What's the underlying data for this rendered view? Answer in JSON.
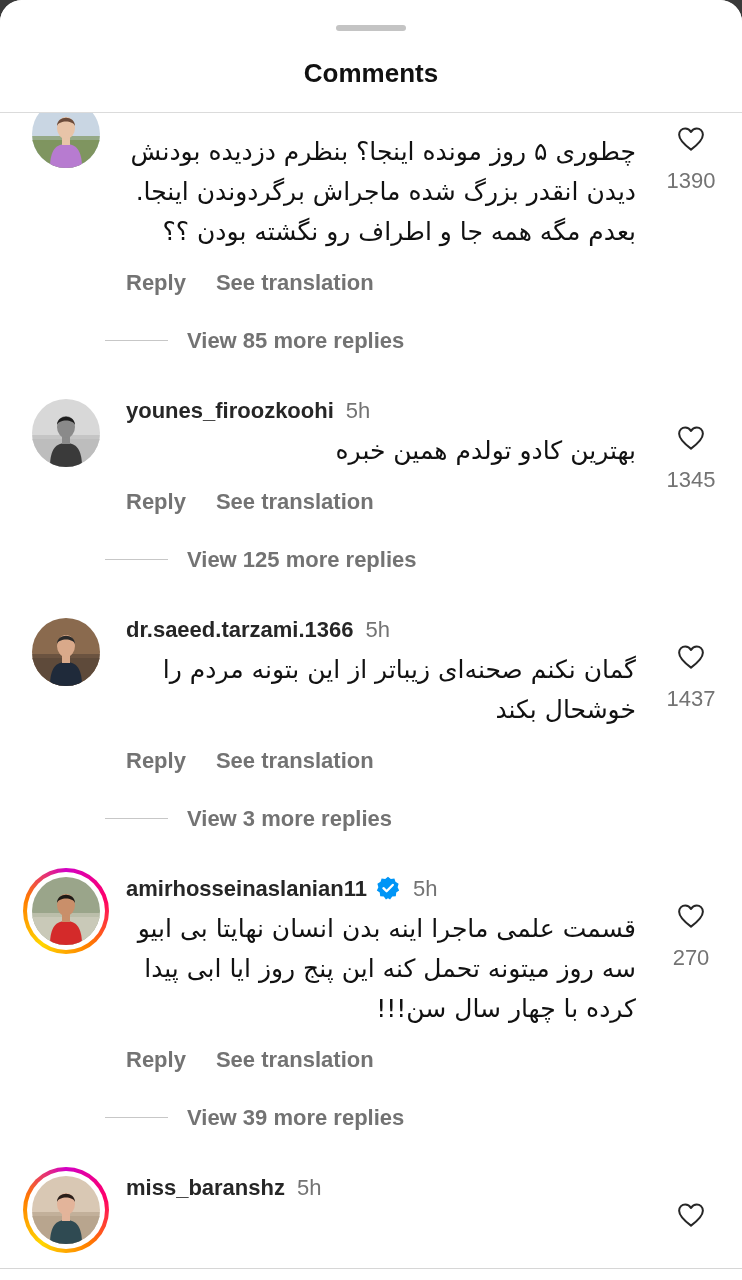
{
  "title": "Comments",
  "comments": [
    {
      "story_ring": false,
      "verified": false,
      "text": "چطوری ۵ روز مونده اینجا؟ بنظرم دزدیده بودنش دیدن انقدر بزرگ شده ماجراش برگردوندن اینجا. بعدم مگه همه جا و اطراف رو نگشته بودن ؟؟",
      "liked": false,
      "likes": "1390",
      "reply": "Reply",
      "translate": "See translation",
      "view_replies": "View 85 more replies"
    },
    {
      "username": "younes_firoozkoohi",
      "time": "5h",
      "story_ring": false,
      "verified": false,
      "text": "بهترین کادو تولدم همین خبره",
      "liked": false,
      "likes": "1345",
      "reply": "Reply",
      "translate": "See translation",
      "view_replies": "View 125 more replies"
    },
    {
      "username": "dr.saeed.tarzami.1366",
      "time": "5h",
      "story_ring": false,
      "verified": false,
      "text": "گمان نکنم صحنه‌ای زیباتر از این بتونه مردم را خوشحال بکند",
      "liked": false,
      "likes": "1437",
      "reply": "Reply",
      "translate": "See translation",
      "view_replies": "View 3 more replies"
    },
    {
      "username": "amirhosseinaslanian11",
      "time": "5h",
      "story_ring": true,
      "verified": true,
      "text": "قسمت علمی ماجرا اینه بدن انسان نهایتا بی ابیو سه روز میتونه تحمل کنه این پنج روز ایا ابی پیدا کرده با چهار سال سن!!!",
      "liked": false,
      "likes": "270",
      "reply": "Reply",
      "translate": "See translation",
      "view_replies": "View 39 more replies"
    },
    {
      "username": "miss_baranshz",
      "time": "5h",
      "story_ring": true,
      "verified": false,
      "liked": false
    }
  ]
}
